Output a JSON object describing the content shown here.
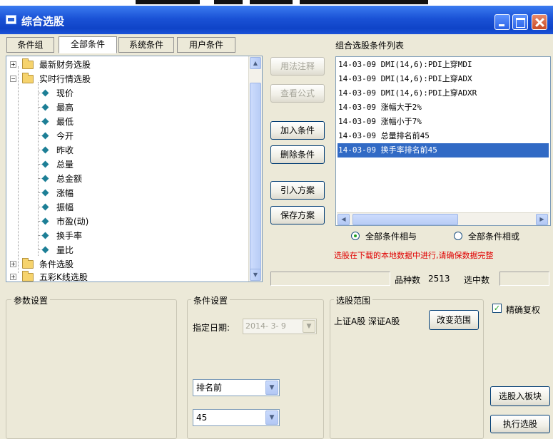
{
  "window": {
    "title": "综合选股"
  },
  "tabs": [
    {
      "label": "条件组"
    },
    {
      "label": "全部条件"
    },
    {
      "label": "系统条件"
    },
    {
      "label": "用户条件"
    }
  ],
  "tree": {
    "folders": [
      "最新财务选股",
      "实时行情选股",
      "条件选股",
      "五彩K线选股"
    ],
    "items": [
      "现价",
      "最高",
      "最低",
      "今开",
      "昨收",
      "总量",
      "总金额",
      "涨幅",
      "振幅",
      "市盈(动)",
      "换手率",
      "量比"
    ]
  },
  "buttons": {
    "usage_note": "用法注释",
    "view_formula": "查看公式",
    "add_condition": "加入条件",
    "delete_condition": "删除条件",
    "import_plan": "引入方案",
    "save_plan": "保存方案",
    "change_range": "改变范围",
    "to_block": "选股入板块",
    "execute": "执行选股"
  },
  "condition_list": {
    "label": "组合选股条件列表",
    "items": [
      "14-03-09 DMI(14,6):PDI上穿MDI",
      "14-03-09 DMI(14,6):PDI上穿ADX",
      "14-03-09 DMI(14,6):PDI上穿ADXR",
      "14-03-09 涨幅大于2%",
      "14-03-09 涨幅小于7%",
      "14-03-09 总量排名前45",
      "14-03-09 换手率排名前45"
    ],
    "selected_index": 6
  },
  "logic": {
    "and_label": "全部条件相与",
    "or_label": "全部条件相或",
    "selected": "and"
  },
  "warning": "选股在下载的本地数据中进行,请确保数据完整",
  "status": {
    "count_label": "品种数",
    "count_value": "2513",
    "selected_label": "选中数",
    "selected_value": ""
  },
  "param_group": {
    "label": "参数设置"
  },
  "cond_group": {
    "label": "条件设置",
    "date_label": "指定日期:",
    "date_value": "2014- 3- 9",
    "rank_select": "排名前",
    "number_select": "45"
  },
  "range_group": {
    "label": "选股范围",
    "markets": "上证A股 深证A股"
  },
  "precise_adjust": {
    "label": "精确复权",
    "checked": true
  }
}
